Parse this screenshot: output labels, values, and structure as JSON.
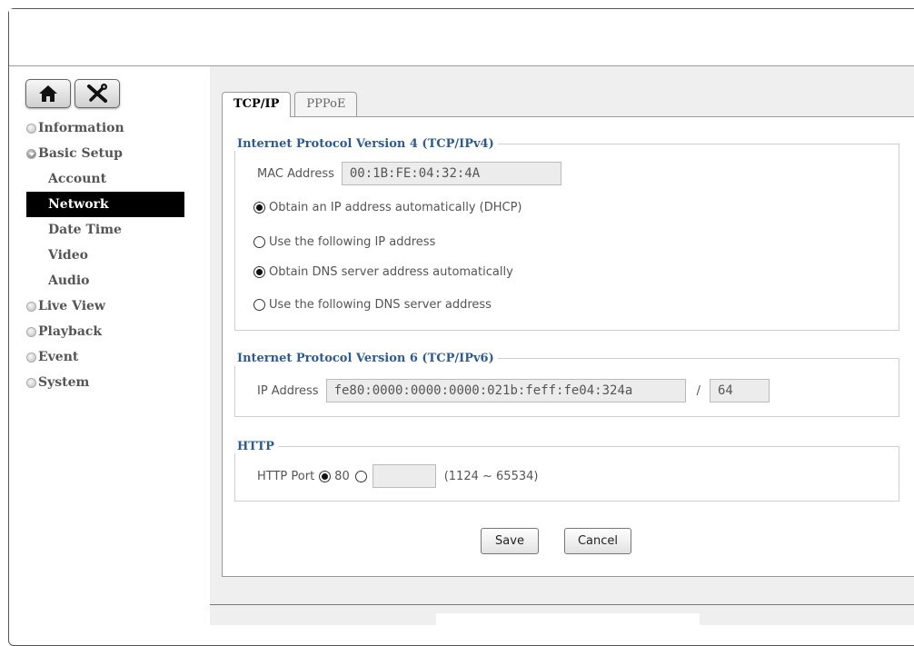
{
  "sidebar": {
    "top_buttons": [
      {
        "icon": "home-icon"
      },
      {
        "icon": "tools-icon"
      }
    ],
    "menu": {
      "information": "Information",
      "basic_setup": "Basic Setup",
      "sub": {
        "account": "Account",
        "network": "Network",
        "date_time": "Date Time",
        "video": "Video",
        "audio": "Audio"
      },
      "live_view": "Live View",
      "playback": "Playback",
      "event": "Event",
      "system": "System"
    },
    "active_item": "Network"
  },
  "tabs": {
    "tcpip": "TCP/IP",
    "pppoe": "PPPoE",
    "active": "TCP/IP"
  },
  "ipv4": {
    "legend": "Internet Protocol Version 4 (TCP/IPv4)",
    "mac_label": "MAC Address",
    "mac_value": "00:1B:FE:04:32:4A",
    "opt_dhcp": "Obtain an IP address automatically (DHCP)",
    "opt_static": "Use the following IP address",
    "opt_dns_auto": "Obtain DNS server address automatically",
    "opt_dns_static": "Use the following DNS server address",
    "ip_mode_selected": "dhcp",
    "dns_mode_selected": "auto"
  },
  "ipv6": {
    "legend": "Internet Protocol Version 6 (TCP/IPv6)",
    "ip_label": "IP Address",
    "ip_value": "fe80:0000:0000:0000:021b:feff:fe04:324a",
    "separator": "/",
    "prefix_value": "64"
  },
  "http": {
    "legend": "HTTP",
    "port_label": "HTTP Port",
    "default_port": "80",
    "custom_port_value": "",
    "range_hint": "(1124 ~ 65534)",
    "selected": "default"
  },
  "actions": {
    "save": "Save",
    "cancel": "Cancel"
  },
  "colors": {
    "legend_blue": "#2f5b8c",
    "active_menu_bg": "#000000"
  }
}
